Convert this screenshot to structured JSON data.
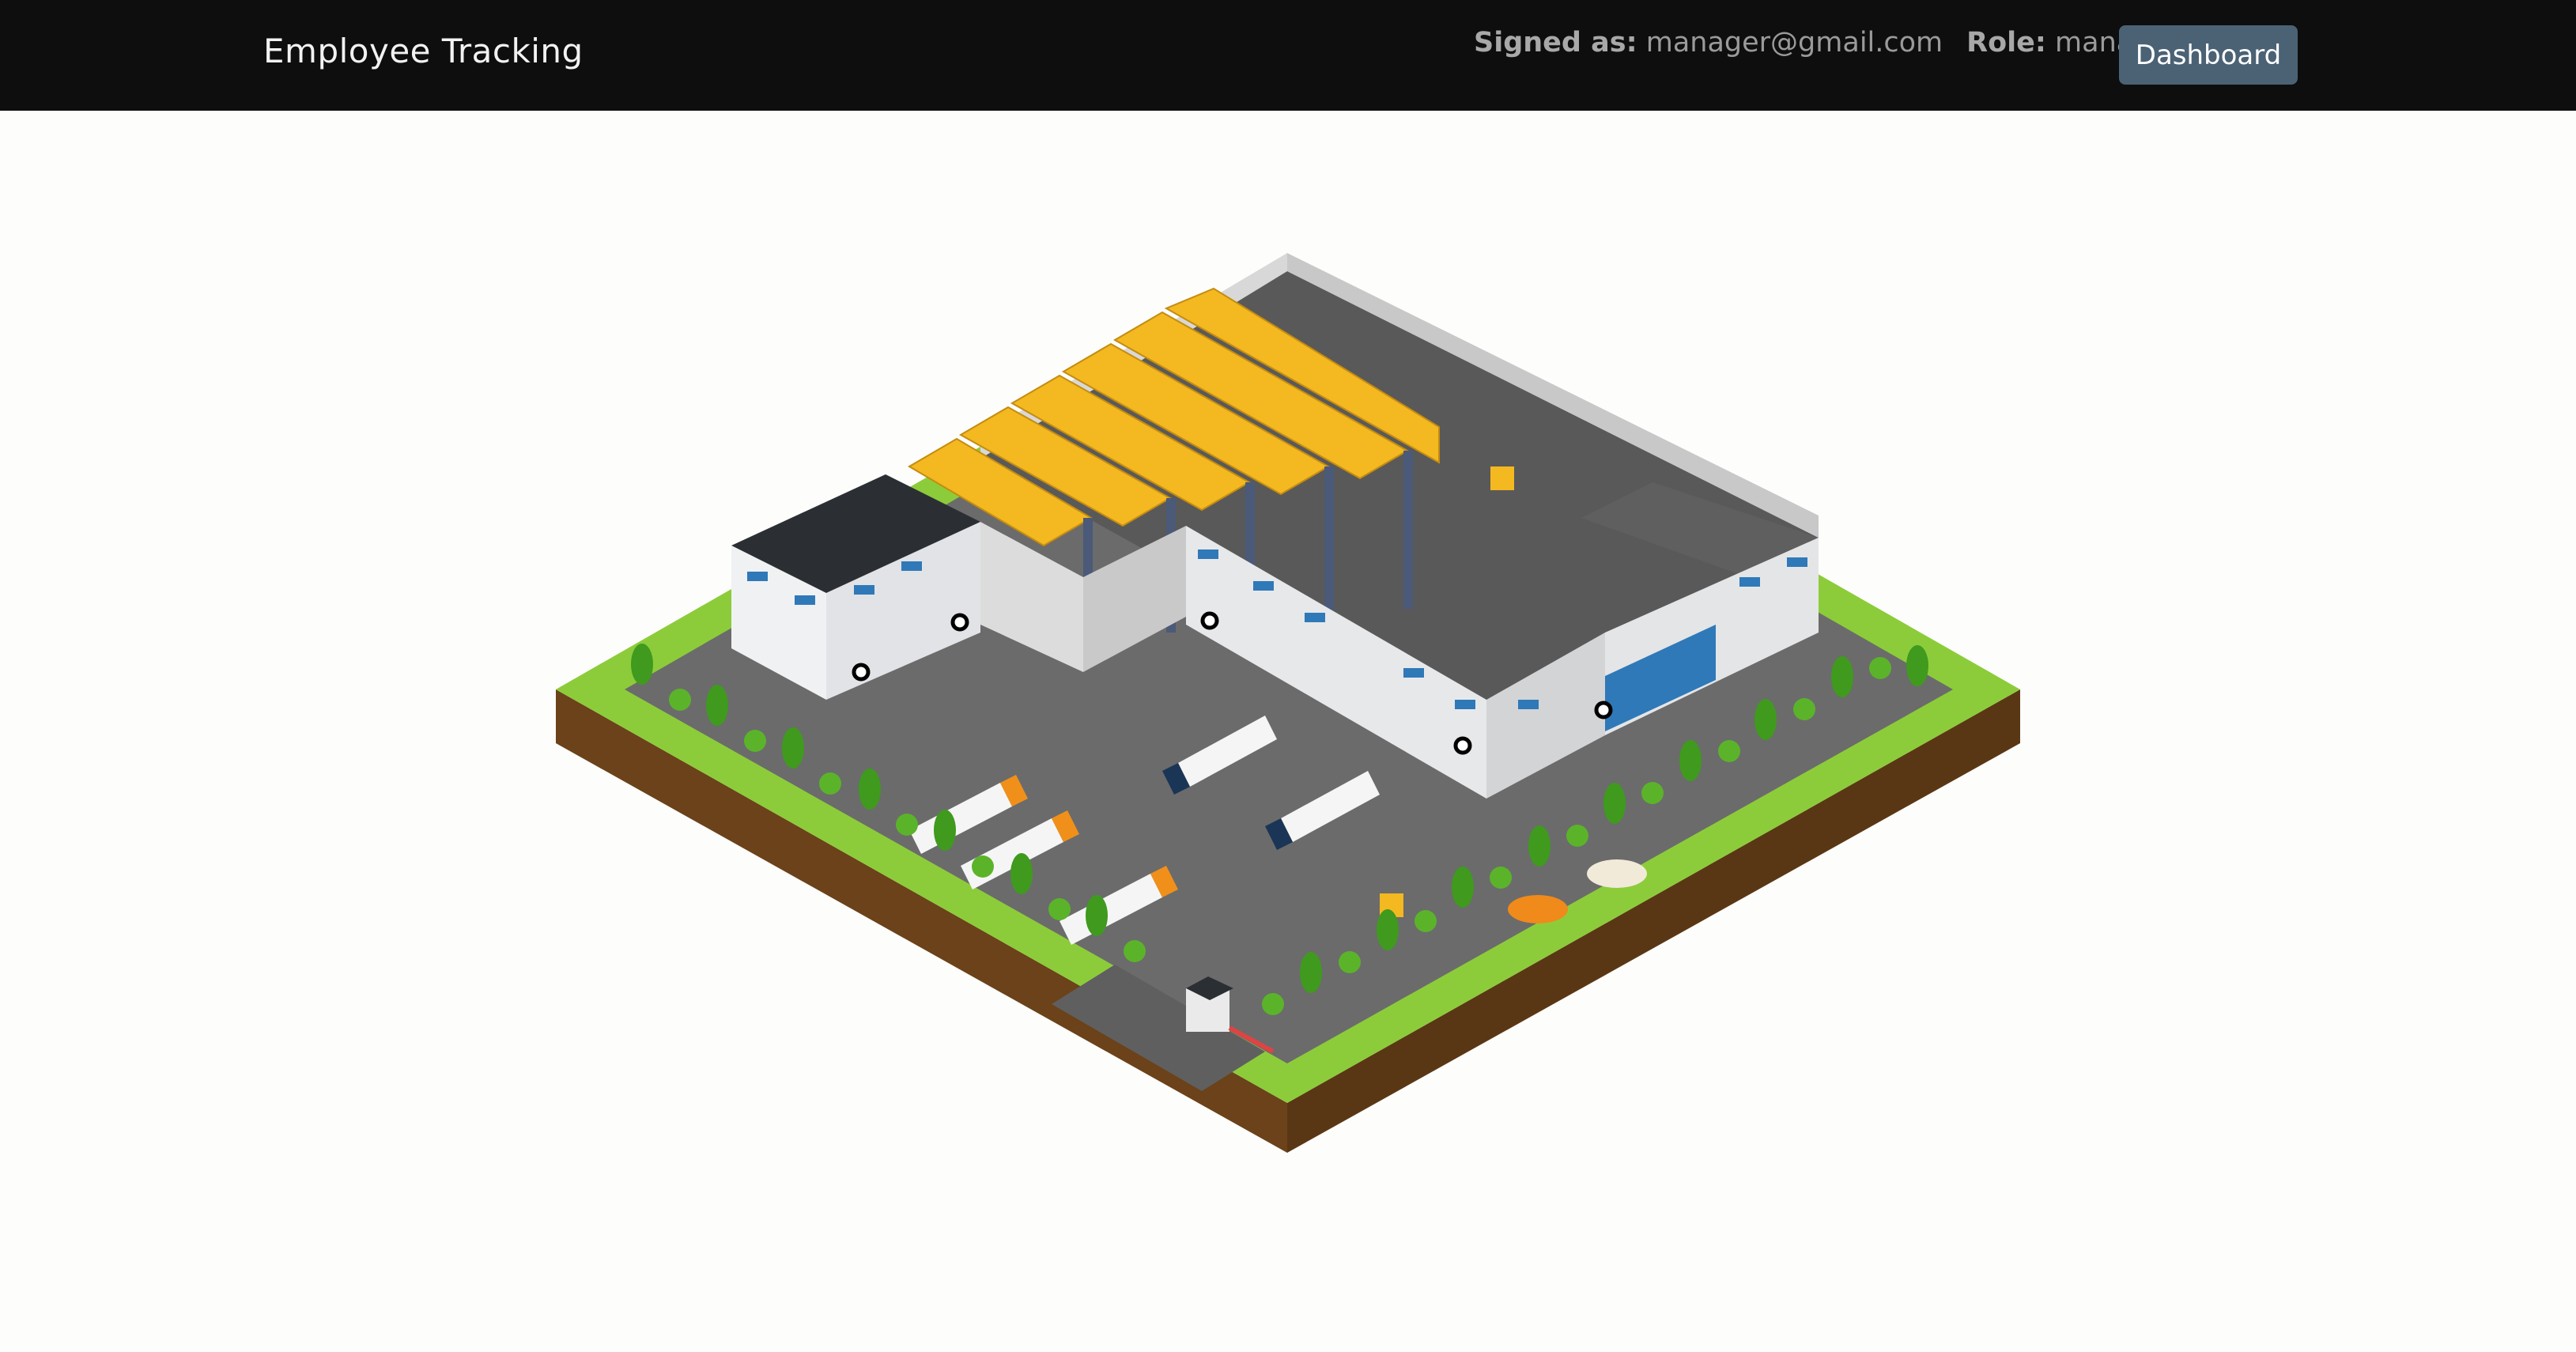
{
  "navbar": {
    "brand": "Employee Tracking",
    "signed_label": "Signed as:",
    "signed_value": "manager@gmail.com",
    "role_label": "Role:",
    "role_value": "manager",
    "dashboard_label": "Dashboard"
  },
  "scene": {
    "description_icon": "isometric-warehouse-map",
    "colors": {
      "grass": "#8ccc3a",
      "soil": "#6b4219",
      "asphalt": "#6e6e6e",
      "wall": "#e6e7e9",
      "roof_dark": "#2b2f33",
      "crate": "#f4b820",
      "rack": "#4a5a78",
      "window": "#2f79b8"
    },
    "marker_count": 7
  }
}
